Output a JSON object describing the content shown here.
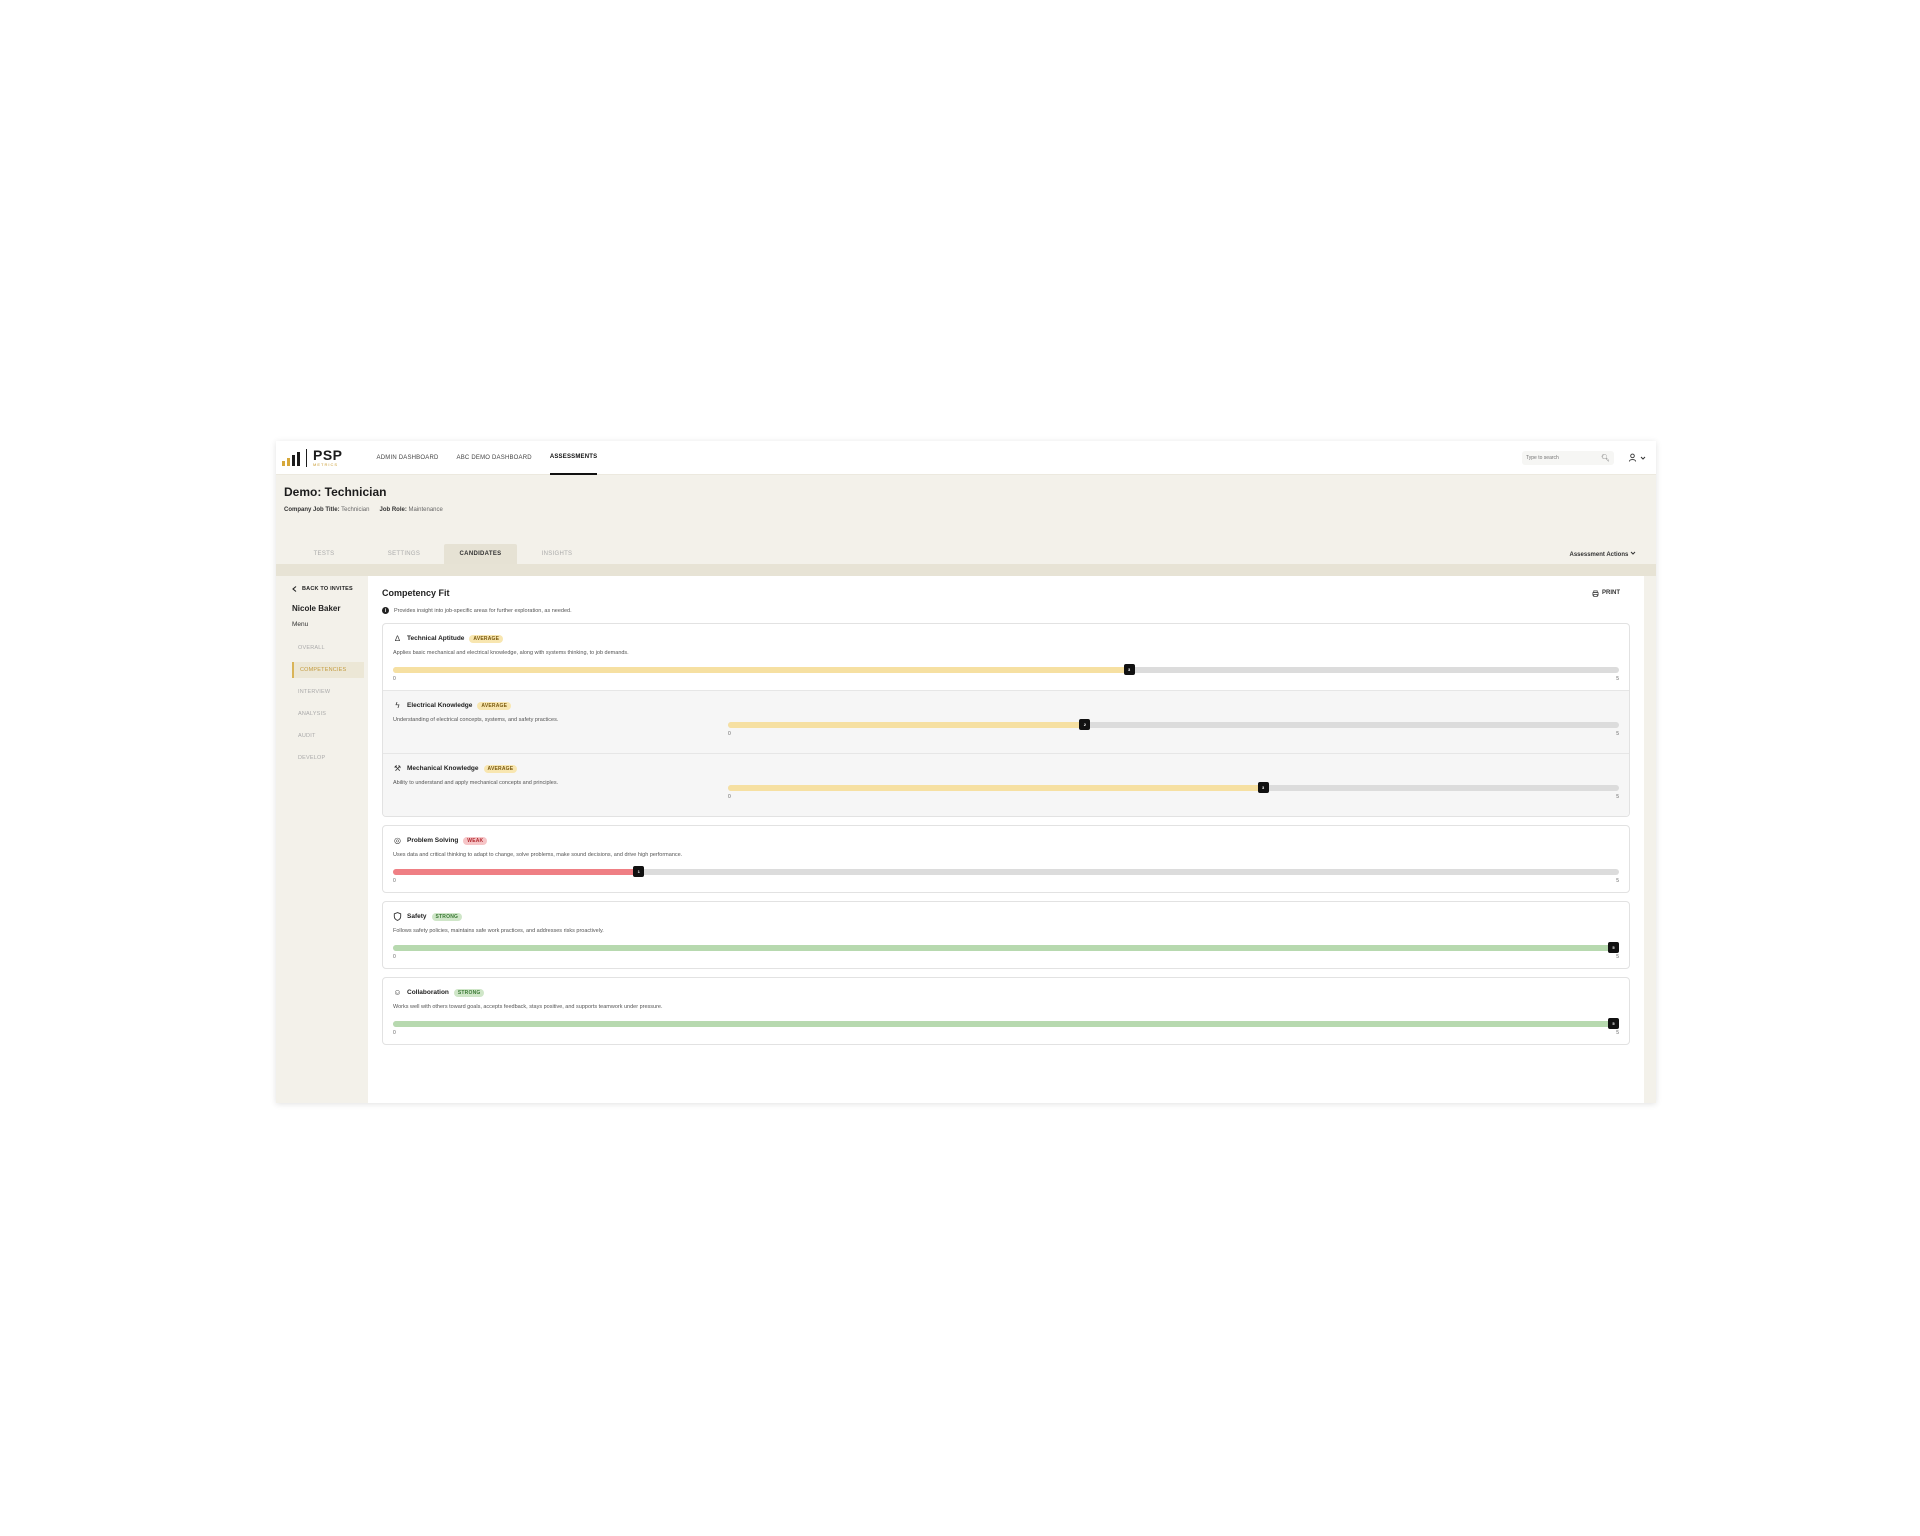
{
  "nav": {
    "logo_text": "PSP",
    "logo_sub": "METRICS",
    "links": [
      "ADMIN DASHBOARD",
      "ABC DEMO DASHBOARD",
      "ASSESSMENTS"
    ],
    "active": "ASSESSMENTS",
    "search_placeholder": "Type to search"
  },
  "header": {
    "title": "Demo: Technician",
    "job_title_label": "Company Job Title:",
    "job_title_value": "Technician",
    "role_label": "Job Role:",
    "role_value": "Maintenance",
    "tabs": [
      "TESTS",
      "SETTINGS",
      "CANDIDATES",
      "INSIGHTS"
    ],
    "active_tab": "CANDIDATES",
    "actions_label": "Assessment Actions"
  },
  "sidebar": {
    "back_label": "BACK TO INVITES",
    "candidate_name": "Nicole Baker",
    "menu_label": "Menu",
    "items": [
      "OVERALL",
      "COMPETENCIES",
      "INTERVIEW",
      "ANALYSIS",
      "AUDIT",
      "DEVELOP"
    ],
    "active": "COMPETENCIES"
  },
  "main": {
    "title": "Competency Fit",
    "print_label": "PRINT",
    "info_text": "Provides insight into job-specific areas for further exploration, as needed.",
    "scale_min": "0",
    "scale_max": "5"
  },
  "competencies": [
    {
      "name": "Technical Aptitude",
      "icon": "compass-icon",
      "rating": "AVERAGE",
      "level": "average",
      "score": 3,
      "desc": "Applies basic mechanical and electrical knowledge, along with systems thinking, to job demands.",
      "sub": false
    },
    {
      "name": "Electrical Knowledge",
      "icon": "lightning-icon",
      "rating": "AVERAGE",
      "level": "average",
      "score": 2,
      "desc": "Understanding of electrical concepts, systems, and safety practices.",
      "sub": true
    },
    {
      "name": "Mechanical Knowledge",
      "icon": "wrench-icon",
      "rating": "AVERAGE",
      "level": "average",
      "score": 3,
      "desc": "Ability to understand and apply mechanical concepts and principles.",
      "sub": true
    },
    {
      "name": "Problem Solving",
      "icon": "brain-icon",
      "rating": "WEAK",
      "level": "weak",
      "score": 1,
      "desc": "Uses data and critical thinking to adapt to change, solve problems, make sound decisions, and drive high performance.",
      "sub": false
    },
    {
      "name": "Safety",
      "icon": "shield-icon",
      "rating": "STRONG",
      "level": "strong",
      "score": 5,
      "desc": "Follows safety policies, maintains safe work practices, and addresses risks proactively.",
      "sub": false
    },
    {
      "name": "Collaboration",
      "icon": "people-icon",
      "rating": "STRONG",
      "level": "strong",
      "score": 5,
      "desc": "Works well with others toward goals, accepts feedback, stays positive, and supports teamwork under pressure.",
      "sub": false
    }
  ],
  "colors": {
    "average": "#f6e0a2",
    "weak": "#ef7f84",
    "strong": "#b7d9af",
    "accent": "#d6a83a"
  }
}
